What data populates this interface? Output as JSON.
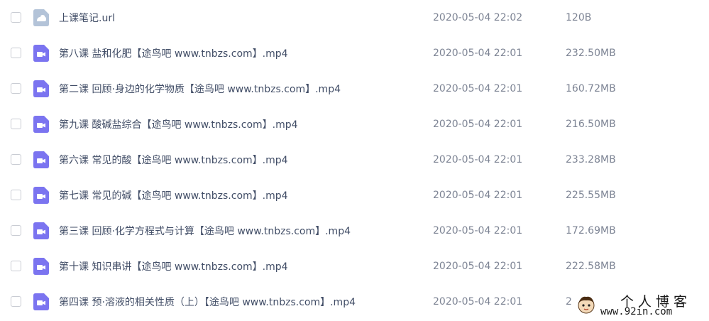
{
  "files": [
    {
      "type": "link",
      "icon": "url-file-icon",
      "name": "上课笔记.url",
      "date": "2020-05-04 22:02",
      "size": "120B"
    },
    {
      "type": "video",
      "icon": "video-file-icon",
      "name": "第八课 盐和化肥【途鸟吧 www.tnbzs.com】.mp4",
      "date": "2020-05-04 22:01",
      "size": "232.50MB"
    },
    {
      "type": "video",
      "icon": "video-file-icon",
      "name": "第二课 回顾·身边的化学物质【途鸟吧 www.tnbzs.com】.mp4",
      "date": "2020-05-04 22:01",
      "size": "160.72MB"
    },
    {
      "type": "video",
      "icon": "video-file-icon",
      "name": "第九课 酸碱盐综合【途鸟吧 www.tnbzs.com】.mp4",
      "date": "2020-05-04 22:01",
      "size": "216.50MB"
    },
    {
      "type": "video",
      "icon": "video-file-icon",
      "name": "第六课 常见的酸【途鸟吧 www.tnbzs.com】.mp4",
      "date": "2020-05-04 22:01",
      "size": "233.28MB"
    },
    {
      "type": "video",
      "icon": "video-file-icon",
      "name": "第七课 常见的碱【途鸟吧 www.tnbzs.com】.mp4",
      "date": "2020-05-04 22:01",
      "size": "225.55MB"
    },
    {
      "type": "video",
      "icon": "video-file-icon",
      "name": "第三课 回顾·化学方程式与计算【途鸟吧 www.tnbzs.com】.mp4",
      "date": "2020-05-04 22:01",
      "size": "172.69MB"
    },
    {
      "type": "video",
      "icon": "video-file-icon",
      "name": "第十课 知识串讲【途鸟吧 www.tnbzs.com】.mp4",
      "date": "2020-05-04 22:01",
      "size": "222.58MB"
    },
    {
      "type": "video",
      "icon": "video-file-icon",
      "name": "第四课 预·溶液的相关性质（上）【途鸟吧 www.tnbzs.com】.mp4",
      "date": "2020-05-04 22:01",
      "size": "2"
    }
  ],
  "watermark": {
    "title": "个人博客",
    "url": "www.92in.com",
    "icon": "cartoon-avatar-icon"
  },
  "colors": {
    "video_icon": "#7b74f0",
    "link_icon": "#b3c3d8",
    "text": "#424e67",
    "muted": "#7d8494",
    "checkbox_border": "#c9ccd3"
  }
}
